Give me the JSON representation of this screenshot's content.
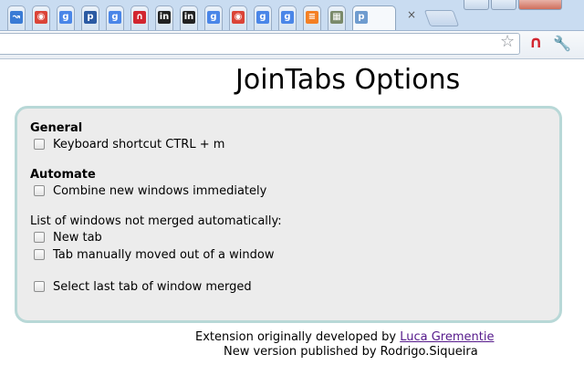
{
  "browser": {
    "tabs": [
      {
        "icon": "arrow-icon",
        "color": "#3a7bd5",
        "glyph": "↝"
      },
      {
        "icon": "chrome-icon",
        "color": "#db4437",
        "glyph": "◉"
      },
      {
        "icon": "google-icon",
        "color": "#4a86e8",
        "glyph": "g"
      },
      {
        "icon": "pinboard-icon",
        "color": "#2b5aa3",
        "glyph": "p"
      },
      {
        "icon": "google-icon",
        "color": "#4a86e8",
        "glyph": "g"
      },
      {
        "icon": "magnet-icon",
        "color": "#d2262f",
        "glyph": "∩"
      },
      {
        "icon": "linkedin-icon",
        "color": "#222222",
        "glyph": "in"
      },
      {
        "icon": "linkedin-icon",
        "color": "#222222",
        "glyph": "in"
      },
      {
        "icon": "google-icon",
        "color": "#4a86e8",
        "glyph": "g"
      },
      {
        "icon": "chrome-icon",
        "color": "#db4437",
        "glyph": "◉"
      },
      {
        "icon": "google-icon",
        "color": "#4a86e8",
        "glyph": "g"
      },
      {
        "icon": "google-icon",
        "color": "#4a86e8",
        "glyph": "g"
      },
      {
        "icon": "stackoverflow-icon",
        "color": "#f48024",
        "glyph": "≡"
      },
      {
        "icon": "image-icon",
        "color": "#7a8a6a",
        "glyph": "▦"
      },
      {
        "icon": "page-icon",
        "color": "#6f9ccf",
        "glyph": "p"
      }
    ],
    "close_tab_symbol": "×"
  },
  "page": {
    "title": "JoinTabs Options",
    "general_heading": "General",
    "keyboard_shortcut_label": "Keyboard shortcut CTRL + m",
    "automate_heading": "Automate",
    "combine_label": "Combine new windows immediately",
    "not_merged_heading": "List of windows not merged automatically:",
    "new_tab_label": "New tab",
    "tab_moved_label": "Tab manually moved out of a window",
    "select_last_label": "Select last tab of window merged",
    "footer_line1_prefix": "Extension originally developed by ",
    "footer_author_link": "Luca Grementie",
    "footer_line2": "New version published by Rodrigo.Siqueira"
  },
  "colors": {
    "options_border": "#b8d8d7",
    "options_background": "#ececec",
    "link": "#551a8b"
  }
}
